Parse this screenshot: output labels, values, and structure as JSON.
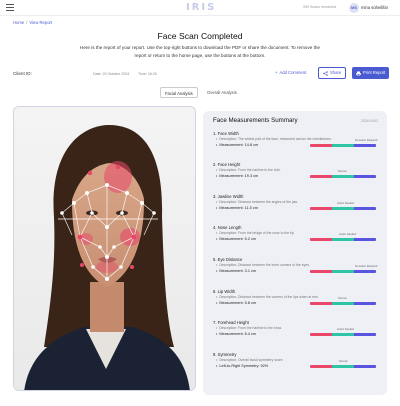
{
  "header": {
    "logo": "IRIS",
    "scans_remaining": "999 Scans remained",
    "avatar_initials": "MS",
    "username": "mina soheilifar"
  },
  "breadcrumb": {
    "home": "Home",
    "separator": "/",
    "current": "View Report"
  },
  "page": {
    "title": "Face Scan Completed",
    "intro": "Here is the report of your report. Use the top-right buttons to download the PDF or share the document. To remove the report or return to the home page, use the buttons at the bottom."
  },
  "meta": {
    "client_label": "Client ID:",
    "date": "Date: 20 October 2024",
    "time": "Time: 16:20"
  },
  "actions": {
    "add_comment": "Add Comment",
    "share": "Share",
    "print": "Print Report"
  },
  "tabs": {
    "facial": "Facial Analysis",
    "overall": "Overall Analysis",
    "active": "facial"
  },
  "summary": {
    "title": "Face Measurements Summary",
    "date": "2024/10/02",
    "metrics": [
      {
        "name": "1. Face Width",
        "description": "Description: The widest part of the face, measured across the cheekbones.",
        "measurement": "Measurement: 14.8 cm",
        "status": "No Action Required"
      },
      {
        "name": "2. Face Height",
        "description": "Description: From the hairline to the chin.",
        "measurement": "Measurement: 19.3 cm",
        "status": "Normal"
      },
      {
        "name": "3. Jawline Width",
        "description": "Description: Distance between the angles of the jaw.",
        "measurement": "Measurement: 11.5 cm",
        "status": "Action Needed"
      },
      {
        "name": "4. Nose Length",
        "description": "Description: From the bridge of the nose to the tip.",
        "measurement": "Measurement: 5.2 cm",
        "status": "Action Needed"
      },
      {
        "name": "5. Eye Distance",
        "description": "Description: Distance between the inner corners of the eyes.",
        "measurement": "Measurement: 3.1 cm",
        "status": "No Action Required"
      },
      {
        "name": "6. Lip Width",
        "description": "Description: Distance between the corners of the lips when at rest.",
        "measurement": "Measurement: 5.8 cm",
        "status": "Normal"
      },
      {
        "name": "7. Forehead Height",
        "description": "Description: From the hairline to the brow.",
        "measurement": "Measurement: 6.4 cm",
        "status": "Action Needed"
      },
      {
        "name": "8. Symmetry",
        "description": "Description: Overall facial symmetry score.",
        "measurement": "Left-to-Right Symmetry: 92%",
        "status": "Normal"
      }
    ]
  },
  "colors": {
    "accent": "#4a5ad1",
    "bar_red": "#e8476a",
    "bar_green": "#2ec4a6",
    "bar_blue": "#5a55e0"
  }
}
